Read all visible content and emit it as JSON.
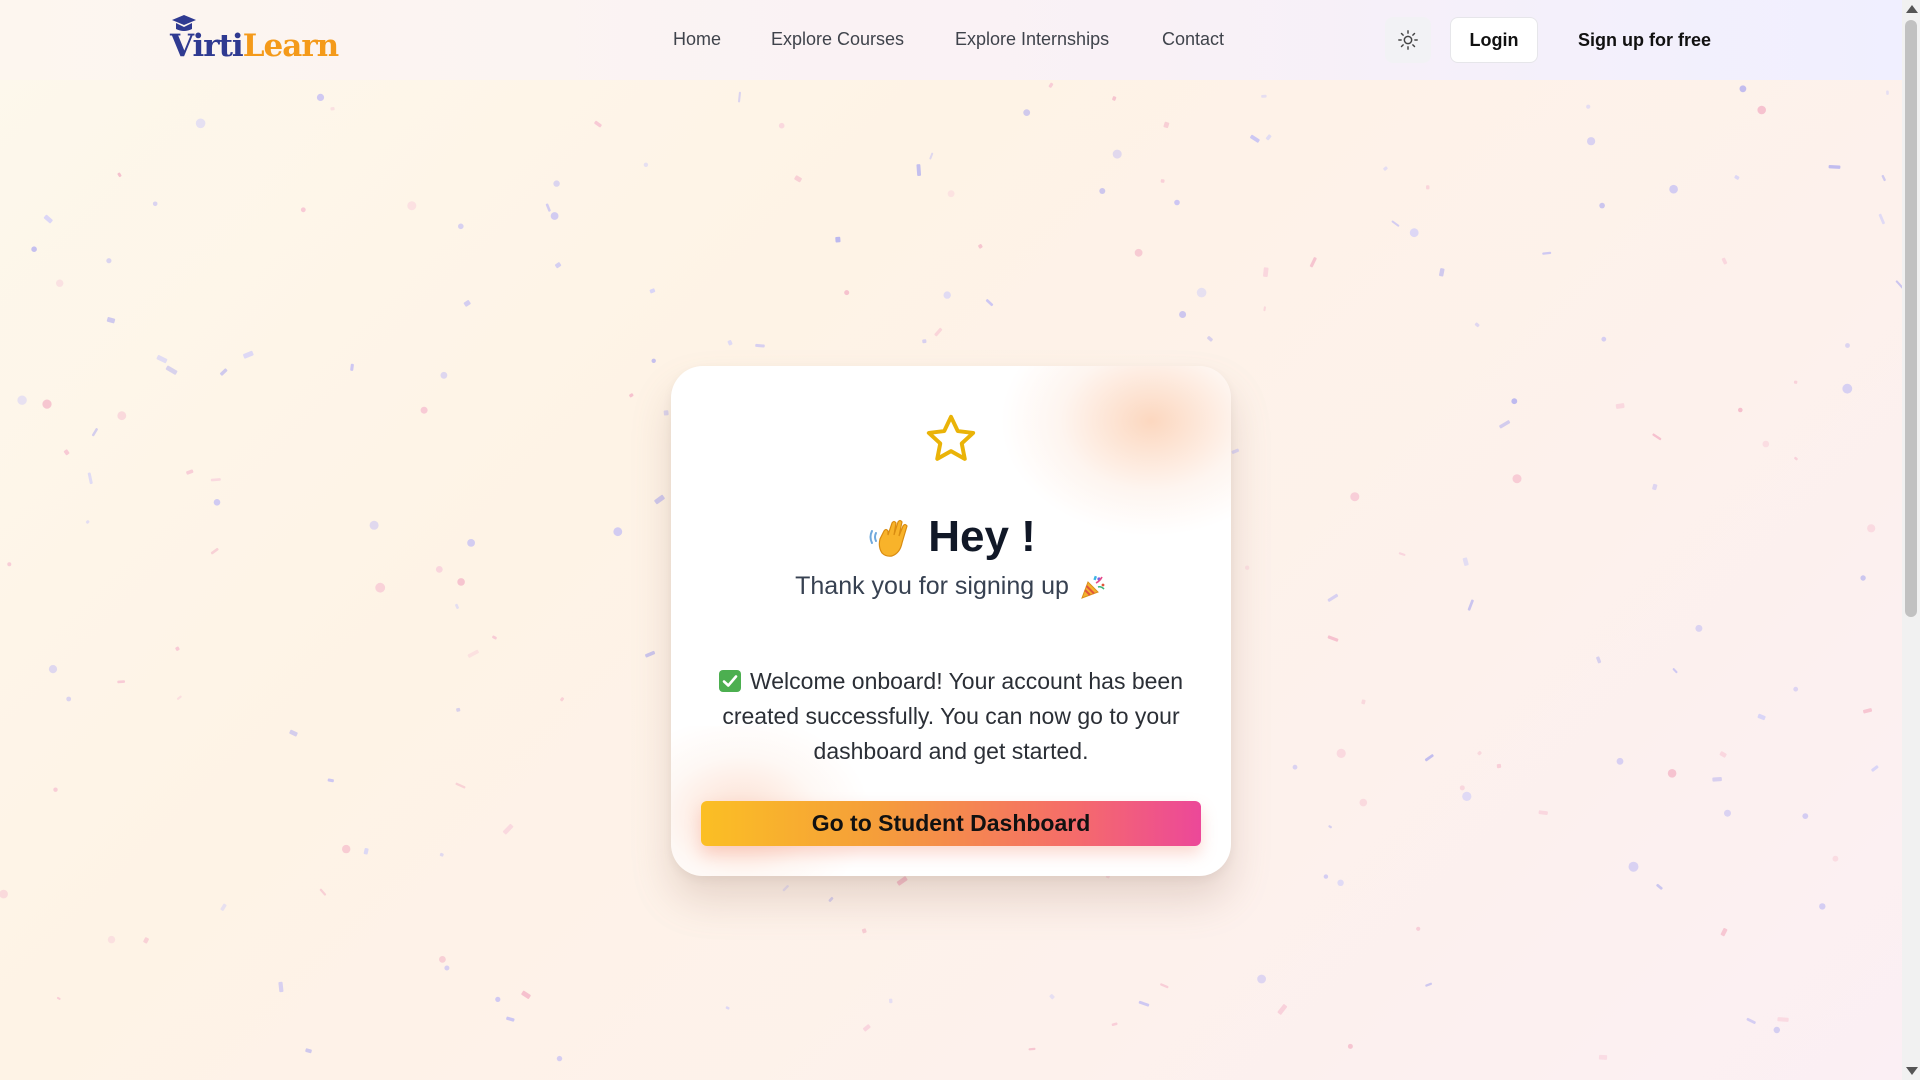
{
  "brand": {
    "logo_part1": "Virti",
    "logo_part2": "Learn"
  },
  "nav": {
    "items": [
      "Home",
      "Explore Courses",
      "Explore Internships",
      "Contact"
    ]
  },
  "header": {
    "theme_toggle_icon": "sun-icon",
    "login_label": "Login",
    "signup_label": "Sign up for free"
  },
  "card": {
    "star_icon": "star-icon",
    "wave_icon": "waving-hand-icon",
    "greeting": "Hey !",
    "subtitle": "Thank you for signing up",
    "party_icon": "party-popper-icon",
    "check_icon": "check-mark-icon",
    "message": "Welcome onboard! Your account has been created successfully. You can now go to your dashboard and get started.",
    "button_label": "Go to Student Dashboard"
  },
  "colors": {
    "accent_star": "#eab308",
    "button_gradient_start": "#fbbf24",
    "button_gradient_end": "#ec4899",
    "logo_blue": "#2f3a91",
    "logo_orange": "#f49a1a"
  }
}
